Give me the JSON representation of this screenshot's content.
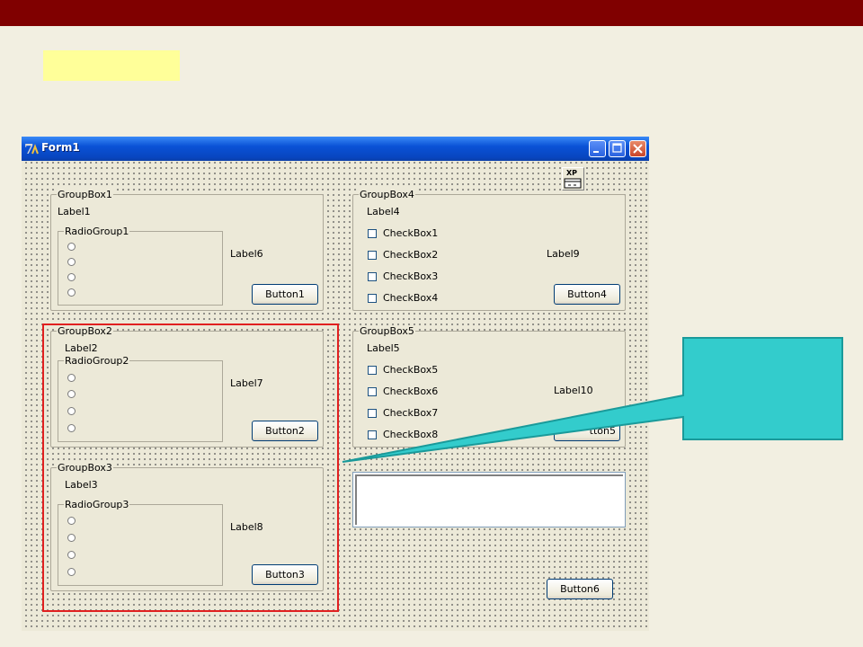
{
  "form": {
    "title": "Form1",
    "xp_label": "XP"
  },
  "groupbox1": {
    "caption": "GroupBox1",
    "label": "Label1",
    "radiogroup_caption": "RadioGroup1",
    "side_label": "Label6",
    "button": "Button1"
  },
  "groupbox2": {
    "caption": "GroupBox2",
    "label": "Label2",
    "radiogroup_caption": "RadioGroup2",
    "side_label": "Label7",
    "button": "Button2"
  },
  "groupbox3": {
    "caption": "GroupBox3",
    "label": "Label3",
    "radiogroup_caption": "RadioGroup3",
    "side_label": "Label8",
    "button": "Button3"
  },
  "groupbox4": {
    "caption": "GroupBox4",
    "label": "Label4",
    "checkboxes": [
      "CheckBox1",
      "CheckBox2",
      "CheckBox3",
      "CheckBox4"
    ],
    "side_label": "Label9",
    "button": "Button4"
  },
  "groupbox5": {
    "caption": "GroupBox5",
    "label": "Label5",
    "checkboxes": [
      "CheckBox5",
      "CheckBox6",
      "CheckBox7",
      "CheckBox8"
    ],
    "side_label": "Label10",
    "button_partial": "tton5"
  },
  "button6": "Button6",
  "colors": {
    "top_bar": "#800000",
    "yellow_box": "#ffff99",
    "highlight": "#e02020",
    "callout": "#33cccc"
  },
  "icons": {
    "form_icon": "delphi-logo-icon",
    "xp_manifest": "xp-manifest-icon",
    "minimize": "minimize-icon",
    "maximize": "maximize-icon",
    "close": "close-icon"
  }
}
